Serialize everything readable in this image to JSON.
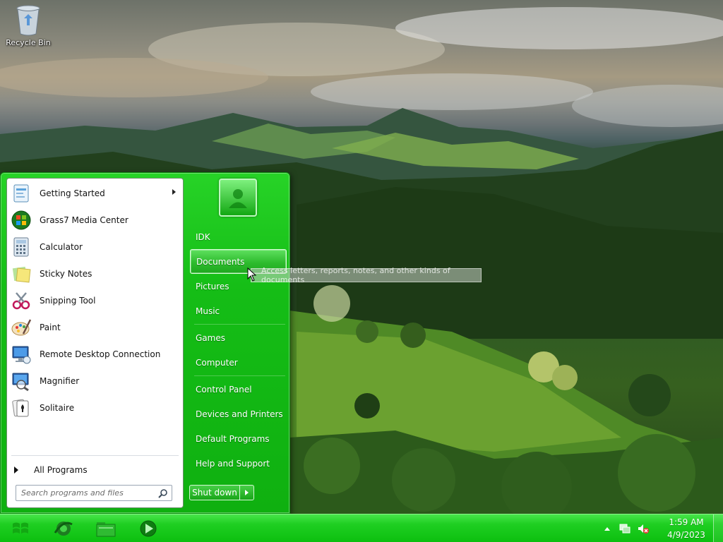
{
  "desktop": {
    "icons": [
      {
        "label": "Recycle Bin",
        "icon": "recycle-bin-icon"
      }
    ]
  },
  "start_menu": {
    "programs": [
      {
        "label": "Getting Started",
        "icon": "getting-started-icon",
        "has_submenu": true
      },
      {
        "label": "Grass7 Media Center",
        "icon": "media-center-icon",
        "has_submenu": false
      },
      {
        "label": "Calculator",
        "icon": "calculator-icon",
        "has_submenu": false
      },
      {
        "label": "Sticky Notes",
        "icon": "sticky-notes-icon",
        "has_submenu": false
      },
      {
        "label": "Snipping Tool",
        "icon": "snipping-tool-icon",
        "has_submenu": false
      },
      {
        "label": "Paint",
        "icon": "paint-icon",
        "has_submenu": false
      },
      {
        "label": "Remote Desktop Connection",
        "icon": "remote-desktop-icon",
        "has_submenu": false
      },
      {
        "label": "Magnifier",
        "icon": "magnifier-icon",
        "has_submenu": false
      },
      {
        "label": "Solitaire",
        "icon": "solitaire-icon",
        "has_submenu": false
      }
    ],
    "all_programs_label": "All Programs",
    "search_placeholder": "Search programs and files",
    "right_items": [
      {
        "label": "IDK",
        "active": false
      },
      {
        "label": "Documents",
        "active": true
      },
      {
        "label": "Pictures",
        "active": false
      },
      {
        "label": "Music",
        "active": false
      },
      {
        "label": "Games",
        "active": false
      },
      {
        "label": "Computer",
        "active": false
      },
      {
        "label": "Control Panel",
        "active": false
      },
      {
        "label": "Devices and Printers",
        "active": false
      },
      {
        "label": "Default Programs",
        "active": false
      },
      {
        "label": "Help and Support",
        "active": false
      }
    ],
    "shutdown_label": "Shut down",
    "tooltip": "Access letters, reports, notes, and other kinds of documents"
  },
  "taskbar": {
    "pinned": [
      "internet-explorer-icon",
      "file-explorer-icon",
      "media-player-icon"
    ],
    "tray_icons": [
      "show-hidden-icons-icon",
      "network-icon",
      "volume-muted-icon"
    ],
    "time": "1:59 AM",
    "date": "4/9/2023"
  },
  "colors": {
    "accent": "#15bd16",
    "taskbar": "#1fcf22",
    "highlight": "#2ebc2e"
  }
}
